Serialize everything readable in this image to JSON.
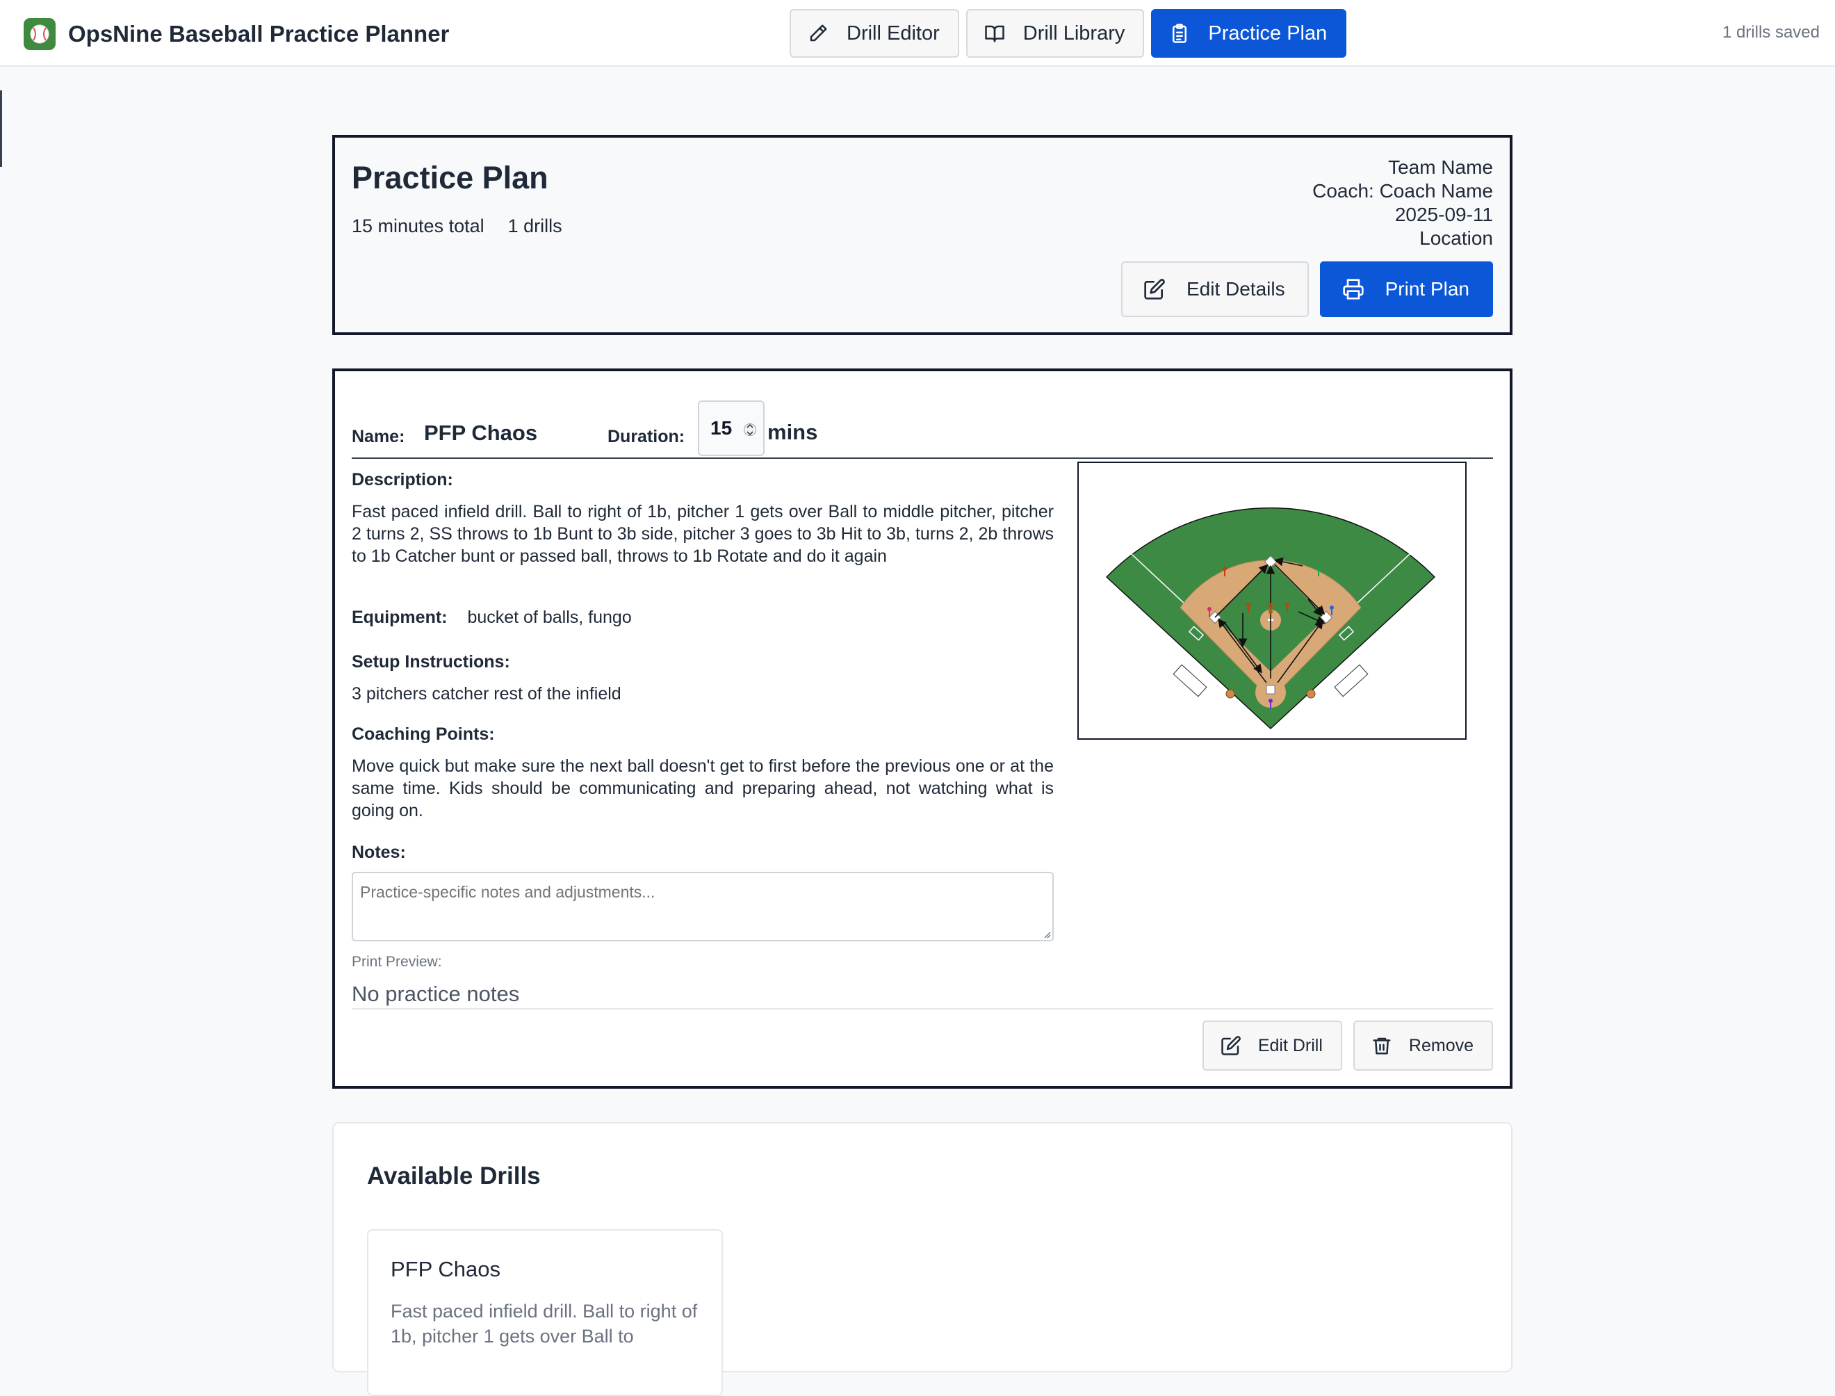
{
  "app": {
    "title": "OpsNine Baseball Practice Planner",
    "saved_status": "1 drills saved",
    "tabs": [
      {
        "label": "Drill Editor",
        "icon": "pencil-icon",
        "active": false
      },
      {
        "label": "Drill Library",
        "icon": "book-icon",
        "active": false
      },
      {
        "label": "Practice Plan",
        "icon": "clipboard-icon",
        "active": true
      }
    ],
    "accent_color": "#0b57d8"
  },
  "plan": {
    "title": "Practice Plan",
    "total_minutes": "15 minutes total",
    "drill_count": "1 drills",
    "team": "Team Name",
    "coach": "Coach: Coach Name",
    "date": "2025-09-11",
    "location": "Location",
    "edit_details_label": "Edit Details",
    "print_label": "Print Plan"
  },
  "drill": {
    "name_label": "Name:",
    "name": "PFP Chaos",
    "duration_label": "Duration:",
    "duration": "15",
    "duration_unit": "mins",
    "description_label": "Description:",
    "description": "Fast paced infield drill. Ball to right of 1b, pitcher 1 gets over Ball to middle pitcher, pitcher 2 turns 2, SS throws to 1b Bunt to 3b side, pitcher 3 goes to 3b Hit to 3b, turns 2, 2b throws to 1b Catcher bunt or passed ball, throws to 1b Rotate and do it again",
    "equipment_label": "Equipment:",
    "equipment": "bucket of balls, fungo",
    "setup_label": "Setup Instructions:",
    "setup": "3 pitchers catcher rest of the infield",
    "coaching_label": "Coaching Points:",
    "coaching": "Move quick but make sure the next ball doesn't get to first before the previous one or at the same time. Kids should be communicating and preparing ahead, not watching what is going on.",
    "notes_label": "Notes:",
    "notes_value": "",
    "notes_placeholder": "Practice-specific notes and adjustments...",
    "print_preview_label": "Print Preview:",
    "print_preview": "No practice notes",
    "edit_label": "Edit Drill",
    "remove_label": "Remove"
  },
  "available": {
    "title": "Available Drills",
    "drills": [
      {
        "name": "PFP Chaos",
        "excerpt": "Fast paced infield drill. Ball to right of 1b, pitcher 1 gets over Ball to"
      }
    ]
  },
  "field_colors": {
    "grass": "#3d8a45",
    "dirt": "#d9a877"
  }
}
